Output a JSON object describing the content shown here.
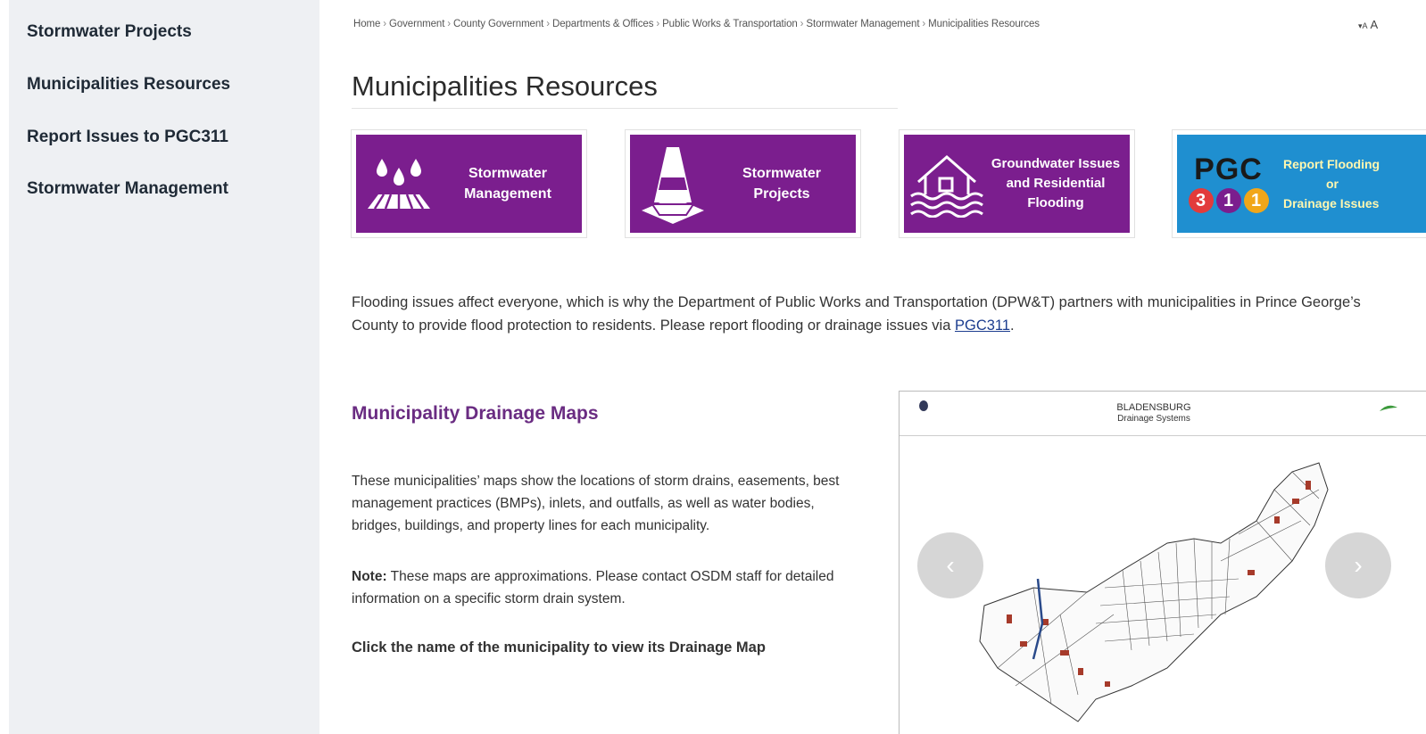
{
  "sidebar": {
    "items": [
      {
        "label": "Stormwater Projects"
      },
      {
        "label": "Municipalities Resources"
      },
      {
        "label": "Report Issues to PGC311"
      },
      {
        "label": "Stormwater Management"
      }
    ]
  },
  "breadcrumb": [
    "Home",
    "Government",
    "County Government",
    "Departments & Offices",
    "Public Works & Transportation",
    "Stormwater Management",
    "Municipalities Resources"
  ],
  "breadcrumb_separator": "›",
  "font_tools": {
    "decrease": "▾A",
    "increase": "A"
  },
  "page_title": "Municipalities Resources",
  "tiles": [
    {
      "lines": [
        "Stormwater",
        "Management"
      ],
      "icon": "rain-field-icon",
      "color": "#7b1e8e"
    },
    {
      "lines": [
        "Stormwater",
        "Projects"
      ],
      "icon": "traffic-cone-icon",
      "color": "#7b1e8e"
    },
    {
      "lines": [
        "Groundwater Issues",
        "and Residential",
        "Flooding"
      ],
      "icon": "flooded-house-icon",
      "color": "#7b1e8e"
    },
    {
      "lines": [
        "Report Flooding",
        "or",
        "Drainage Issues"
      ],
      "icon": "pgc311-logo",
      "color": "#1f8fd0",
      "logo_text": "PGC",
      "logo_digits": [
        "3",
        "1",
        "1"
      ]
    }
  ],
  "intro": {
    "text": "Flooding issues affect everyone, which is why the Department of Public Works and Transportation (DPW&T) partners with municipalities in Prince George’s County to provide flood protection to residents. Please report flooding or drainage issues via ",
    "link": "PGC311",
    "end": "."
  },
  "drainage": {
    "title": "Municipality Drainage Maps",
    "paragraph": "These municipalities’ maps show the locations of storm drains, easements, best management practices (BMPs), inlets, and outfalls, as well as water bodies, bridges, buildings, and property lines for each municipality.",
    "note_label": "Note:",
    "note_text": " These maps are approximations. Please contact OSDM staff for detailed information on a specific storm drain system.",
    "click_text": "Click the name of the municipality to view its Drainage Map"
  },
  "map": {
    "title_line1": "BLADENSBURG",
    "title_line2": "Drainage Systems",
    "prev_icon": "‹",
    "next_icon": "›"
  }
}
